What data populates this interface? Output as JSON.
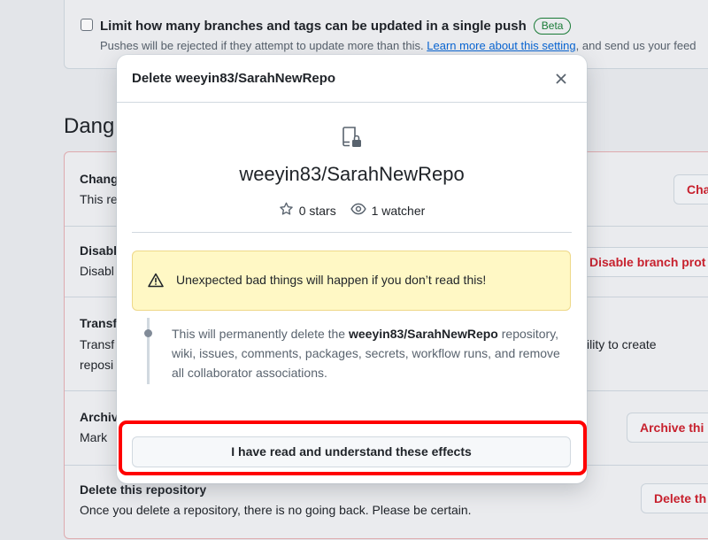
{
  "push_limit": {
    "title": "Limit how many branches and tags can be updated in a single push",
    "badge": "Beta",
    "desc_start": "Pushes will be rejected if they attempt to update more than this. ",
    "desc_link": "Learn more about this setting",
    "desc_end": ", and send us your feed"
  },
  "danger": {
    "heading": "Dang",
    "rows": [
      {
        "title": "Chang",
        "desc": "This re",
        "button": "Cha"
      },
      {
        "title": "Disabl",
        "desc": "Disabl",
        "button": "Disable branch prot"
      },
      {
        "title": "Transf",
        "desc": "Transf",
        "desc2": "reposi",
        "side_text": "ility to create"
      },
      {
        "title": "Archiv",
        "desc": "Mark",
        "button": "Archive thi"
      },
      {
        "title": "Delete this repository",
        "desc": "Once you delete a repository, there is no going back. Please be certain.",
        "button": "Delete th"
      }
    ]
  },
  "dialog": {
    "title": "Delete weeyin83/SarahNewRepo",
    "repo_name": "weeyin83/SarahNewRepo",
    "stars": "0 stars",
    "watchers": "1 watcher",
    "warning": "Unexpected bad things will happen if you don’t read this!",
    "effects_prefix": "This will permanently delete the ",
    "effects_repo": "weeyin83/SarahNewRepo",
    "effects_suffix": " repository, wiki, issues, comments, packages, secrets, workflow runs, and remove all collaborator associations.",
    "confirm_button": "I have read and understand these effects"
  },
  "icons": {
    "close": "close-icon",
    "repo_locked": "repo-locked-icon",
    "star": "star-icon",
    "eye": "eye-icon",
    "alert": "alert-icon"
  },
  "colors": {
    "danger": "#cf222e",
    "link": "#0969da",
    "warning_bg": "#fff8c5",
    "highlight": "#ff0000"
  }
}
